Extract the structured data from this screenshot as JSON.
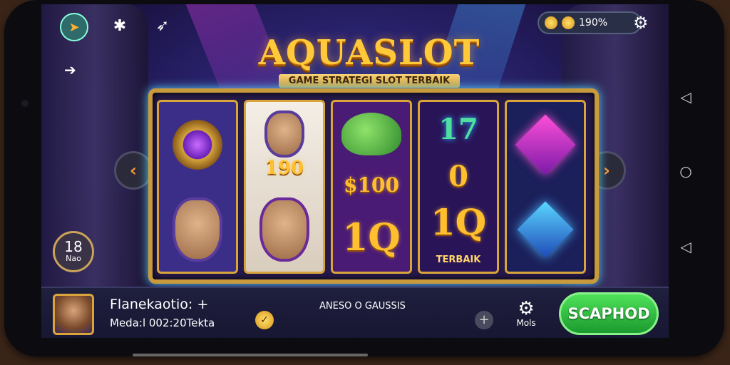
{
  "header": {
    "coins_value": "190%",
    "logo_title": "AQUASLOT",
    "logo_subtitle": "GAME STRATEGI SLOT TERBAIK"
  },
  "reels": {
    "r2_label": "190",
    "r3_top_label": "$100",
    "r3_bottom_label": "1Q",
    "r4_top": "17",
    "r4_mid": "0",
    "r4_bottom": "1Q",
    "r4_caption": "TERBAIK"
  },
  "level": {
    "number": "18",
    "label": "Nao"
  },
  "player": {
    "name": "Flanekaotio: +",
    "info": "Meda:l 002:20Tekta"
  },
  "bottom": {
    "center_label": "ANESO O GAUSSIS",
    "more_label": "Mols",
    "spin_label": "SCAPHOD"
  },
  "icons": [
    "arrow-icon",
    "puzzle-icon",
    "rocket-icon",
    "gear-icon",
    "grid-icon"
  ]
}
